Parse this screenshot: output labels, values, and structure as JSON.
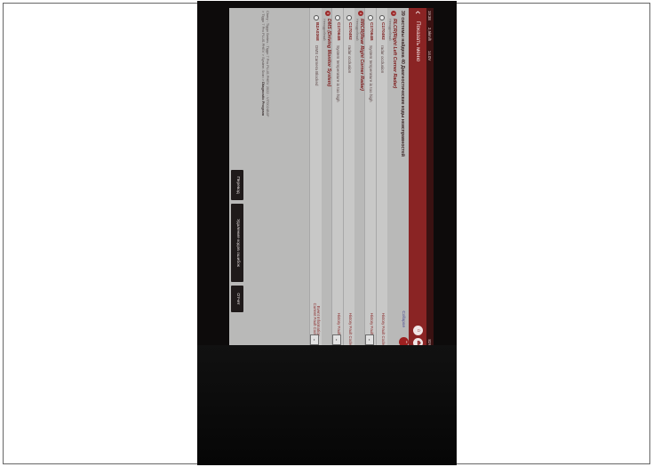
{
  "status_bar": {
    "time": "19:38",
    "date": "2,5km/h",
    "icons": "14.0V",
    "battery": "81%"
  },
  "header": {
    "title": "Показать меню"
  },
  "summary": "39 системы найдена 40 Диагностические коды неисправностей",
  "collapse_label": "Collapse",
  "systems": [
    {
      "number": "3",
      "name": "RLCR(Right Left Corner Radar)",
      "sub": "Неподробный",
      "faults": [
        {
          "code": "C170492",
          "desc": "radar occlusion",
          "status": "History Fault Code"
        },
        {
          "code": "C17064B",
          "desc": "System temperature is too high",
          "status": "History Fault Code"
        }
      ]
    },
    {
      "number": "4",
      "name": "RRCR(Rear Right Corner Radar)",
      "sub": "Неподробный",
      "faults": [
        {
          "code": "C170492",
          "desc": "radar occlusion",
          "status": "History Fault Code"
        },
        {
          "code": "C17064B",
          "desc": "System temperature is too high",
          "status": "History Fault Code"
        }
      ]
    },
    {
      "number": "5",
      "name": "DMS (Driving Monitor System)",
      "sub": "Неподробный",
      "faults": [
        {
          "code": "B2A0368",
          "desc": "DMS Camera Blocked",
          "status": "Event Information Current Fault Code"
        }
      ]
    }
  ],
  "vehicle_line1": "Chery : Tiggo Series : Tiggo 7 Pro PLUS PHEV 2022 : VIT0024B0F",
  "vehicle_line2_prefix": "> Tiggo 7 Pro PLUS PHEV > System Scan > ",
  "vehicle_line2_bold": "Diagnostic Program",
  "buttons": {
    "translate": "Перевод",
    "clear_codes": "Удаление кодов ошибок",
    "report": "Отчет"
  }
}
